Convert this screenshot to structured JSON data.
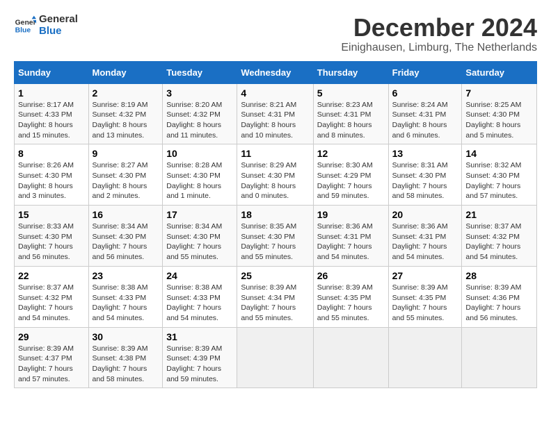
{
  "header": {
    "logo_line1": "General",
    "logo_line2": "Blue",
    "title": "December 2024",
    "subtitle": "Einighausen, Limburg, The Netherlands"
  },
  "calendar": {
    "days_of_week": [
      "Sunday",
      "Monday",
      "Tuesday",
      "Wednesday",
      "Thursday",
      "Friday",
      "Saturday"
    ],
    "weeks": [
      [
        {
          "day": "1",
          "sunrise": "8:17 AM",
          "sunset": "4:33 PM",
          "daylight": "8 hours and 15 minutes."
        },
        {
          "day": "2",
          "sunrise": "8:19 AM",
          "sunset": "4:32 PM",
          "daylight": "8 hours and 13 minutes."
        },
        {
          "day": "3",
          "sunrise": "8:20 AM",
          "sunset": "4:32 PM",
          "daylight": "8 hours and 11 minutes."
        },
        {
          "day": "4",
          "sunrise": "8:21 AM",
          "sunset": "4:31 PM",
          "daylight": "8 hours and 10 minutes."
        },
        {
          "day": "5",
          "sunrise": "8:23 AM",
          "sunset": "4:31 PM",
          "daylight": "8 hours and 8 minutes."
        },
        {
          "day": "6",
          "sunrise": "8:24 AM",
          "sunset": "4:31 PM",
          "daylight": "8 hours and 6 minutes."
        },
        {
          "day": "7",
          "sunrise": "8:25 AM",
          "sunset": "4:30 PM",
          "daylight": "8 hours and 5 minutes."
        }
      ],
      [
        {
          "day": "8",
          "sunrise": "8:26 AM",
          "sunset": "4:30 PM",
          "daylight": "8 hours and 3 minutes."
        },
        {
          "day": "9",
          "sunrise": "8:27 AM",
          "sunset": "4:30 PM",
          "daylight": "8 hours and 2 minutes."
        },
        {
          "day": "10",
          "sunrise": "8:28 AM",
          "sunset": "4:30 PM",
          "daylight": "8 hours and 1 minute."
        },
        {
          "day": "11",
          "sunrise": "8:29 AM",
          "sunset": "4:30 PM",
          "daylight": "8 hours and 0 minutes."
        },
        {
          "day": "12",
          "sunrise": "8:30 AM",
          "sunset": "4:29 PM",
          "daylight": "7 hours and 59 minutes."
        },
        {
          "day": "13",
          "sunrise": "8:31 AM",
          "sunset": "4:30 PM",
          "daylight": "7 hours and 58 minutes."
        },
        {
          "day": "14",
          "sunrise": "8:32 AM",
          "sunset": "4:30 PM",
          "daylight": "7 hours and 57 minutes."
        }
      ],
      [
        {
          "day": "15",
          "sunrise": "8:33 AM",
          "sunset": "4:30 PM",
          "daylight": "7 hours and 56 minutes."
        },
        {
          "day": "16",
          "sunrise": "8:34 AM",
          "sunset": "4:30 PM",
          "daylight": "7 hours and 56 minutes."
        },
        {
          "day": "17",
          "sunrise": "8:34 AM",
          "sunset": "4:30 PM",
          "daylight": "7 hours and 55 minutes."
        },
        {
          "day": "18",
          "sunrise": "8:35 AM",
          "sunset": "4:30 PM",
          "daylight": "7 hours and 55 minutes."
        },
        {
          "day": "19",
          "sunrise": "8:36 AM",
          "sunset": "4:31 PM",
          "daylight": "7 hours and 54 minutes."
        },
        {
          "day": "20",
          "sunrise": "8:36 AM",
          "sunset": "4:31 PM",
          "daylight": "7 hours and 54 minutes."
        },
        {
          "day": "21",
          "sunrise": "8:37 AM",
          "sunset": "4:32 PM",
          "daylight": "7 hours and 54 minutes."
        }
      ],
      [
        {
          "day": "22",
          "sunrise": "8:37 AM",
          "sunset": "4:32 PM",
          "daylight": "7 hours and 54 minutes."
        },
        {
          "day": "23",
          "sunrise": "8:38 AM",
          "sunset": "4:33 PM",
          "daylight": "7 hours and 54 minutes."
        },
        {
          "day": "24",
          "sunrise": "8:38 AM",
          "sunset": "4:33 PM",
          "daylight": "7 hours and 54 minutes."
        },
        {
          "day": "25",
          "sunrise": "8:39 AM",
          "sunset": "4:34 PM",
          "daylight": "7 hours and 55 minutes."
        },
        {
          "day": "26",
          "sunrise": "8:39 AM",
          "sunset": "4:35 PM",
          "daylight": "7 hours and 55 minutes."
        },
        {
          "day": "27",
          "sunrise": "8:39 AM",
          "sunset": "4:35 PM",
          "daylight": "7 hours and 55 minutes."
        },
        {
          "day": "28",
          "sunrise": "8:39 AM",
          "sunset": "4:36 PM",
          "daylight": "7 hours and 56 minutes."
        }
      ],
      [
        {
          "day": "29",
          "sunrise": "8:39 AM",
          "sunset": "4:37 PM",
          "daylight": "7 hours and 57 minutes."
        },
        {
          "day": "30",
          "sunrise": "8:39 AM",
          "sunset": "4:38 PM",
          "daylight": "7 hours and 58 minutes."
        },
        {
          "day": "31",
          "sunrise": "8:39 AM",
          "sunset": "4:39 PM",
          "daylight": "7 hours and 59 minutes."
        },
        null,
        null,
        null,
        null
      ]
    ],
    "labels": {
      "sunrise": "Sunrise:",
      "sunset": "Sunset:",
      "daylight": "Daylight:"
    }
  }
}
